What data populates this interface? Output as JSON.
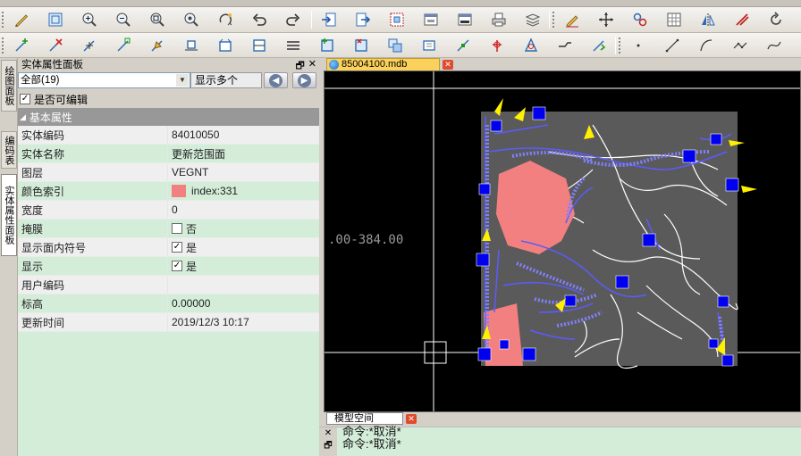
{
  "menu": {
    "items": [
      "",
      "",
      "",
      ""
    ]
  },
  "panel": {
    "title": "实体属性面板",
    "filter_value": "全部(19)",
    "show_many": "显示多个",
    "editable_label": "是否可编辑",
    "editable_checked": "✓",
    "section": "基本属性",
    "rows": [
      {
        "label": "实体编码",
        "value": "84010050"
      },
      {
        "label": "实体名称",
        "value": "更新范围面"
      },
      {
        "label": "图层",
        "value": "VEGNT"
      },
      {
        "label": "颜色索引",
        "value": "index:331"
      },
      {
        "label": "宽度",
        "value": "0"
      },
      {
        "label": "掩膜",
        "value": "否"
      },
      {
        "label": "显示面内符号",
        "value": "是"
      },
      {
        "label": "显示",
        "value": "是"
      },
      {
        "label": "用户编码",
        "value": ""
      },
      {
        "label": "标高",
        "value": "0.00000"
      },
      {
        "label": "更新时间",
        "value": "2019/12/3 10:17"
      }
    ],
    "color_swatch": "#f28080"
  },
  "side_tabs": [
    "绘图面板",
    "编码表",
    "实体属性面板"
  ],
  "document": {
    "tab_label": "85004100.mdb",
    "coord_text": ".00-384.00",
    "model_tab": "模型空间"
  },
  "command": {
    "lines": [
      "命令:*取消*",
      "命令:*取消*"
    ]
  },
  "colors": {
    "accent_tab": "#fbd15c",
    "panel_bg": "#d4edd9",
    "highlight": "#f28080",
    "marker": "#0000ff"
  }
}
